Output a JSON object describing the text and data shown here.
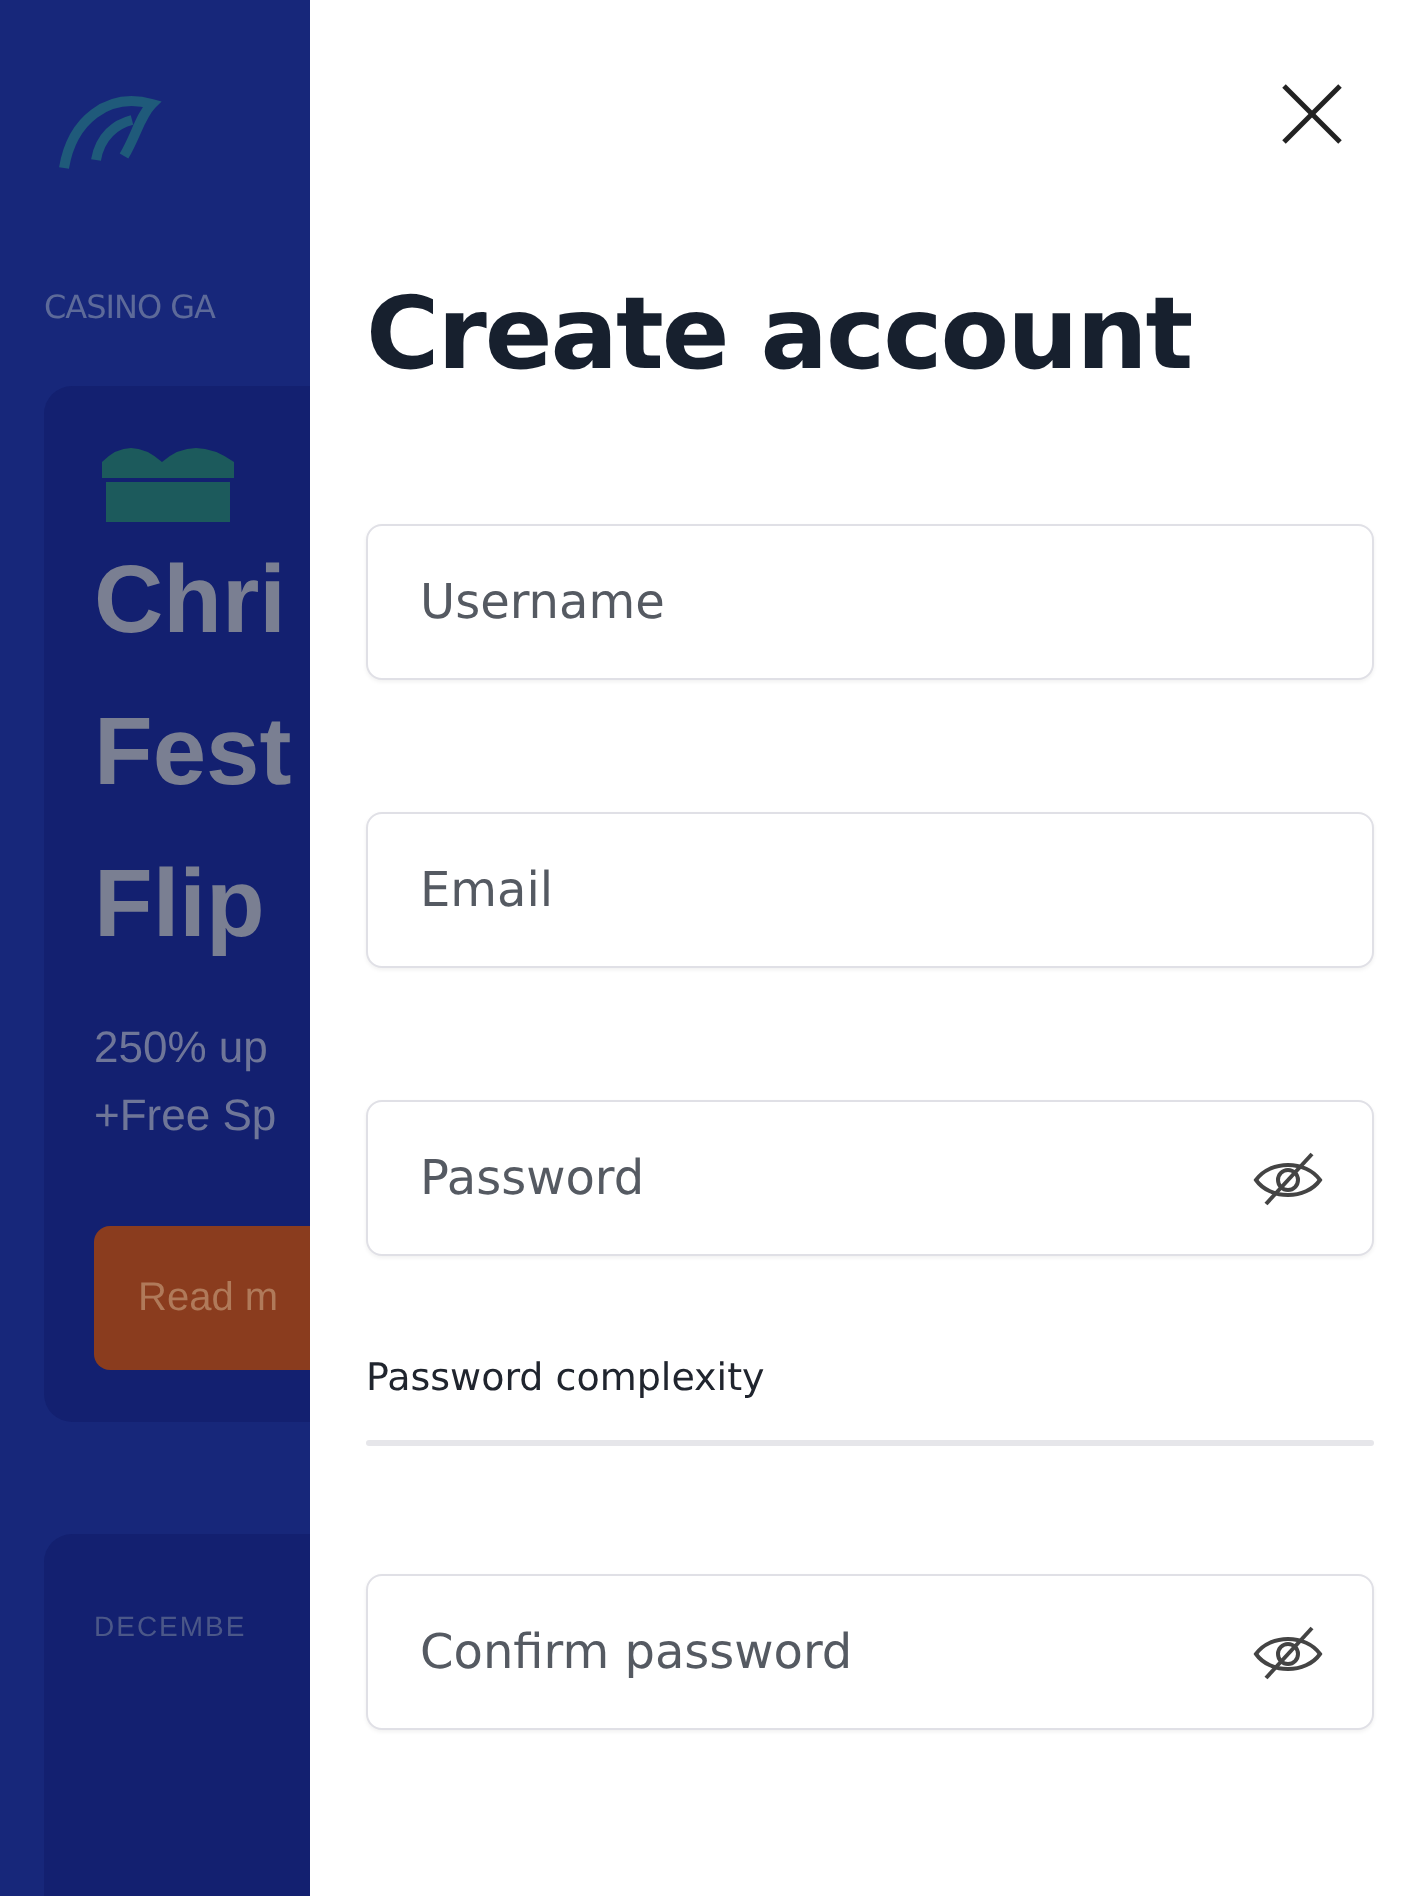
{
  "background": {
    "nav_label": "CASINO GA",
    "promo": {
      "title_lines": [
        "Chri",
        "Fest",
        "Flip"
      ],
      "text_lines": [
        "250% up",
        "+Free Sp"
      ],
      "button": "Read m"
    },
    "next_card": {
      "label": "DECEMBE"
    }
  },
  "drawer": {
    "title": "Create account",
    "fields": [
      {
        "placeholder": "Username",
        "kind": "text"
      },
      {
        "placeholder": "Email",
        "kind": "text"
      },
      {
        "placeholder": "Password",
        "kind": "password"
      },
      {
        "kind": "meter",
        "label": "Password complexity",
        "level": 0
      },
      {
        "placeholder": "Confirm password",
        "kind": "password"
      }
    ]
  }
}
